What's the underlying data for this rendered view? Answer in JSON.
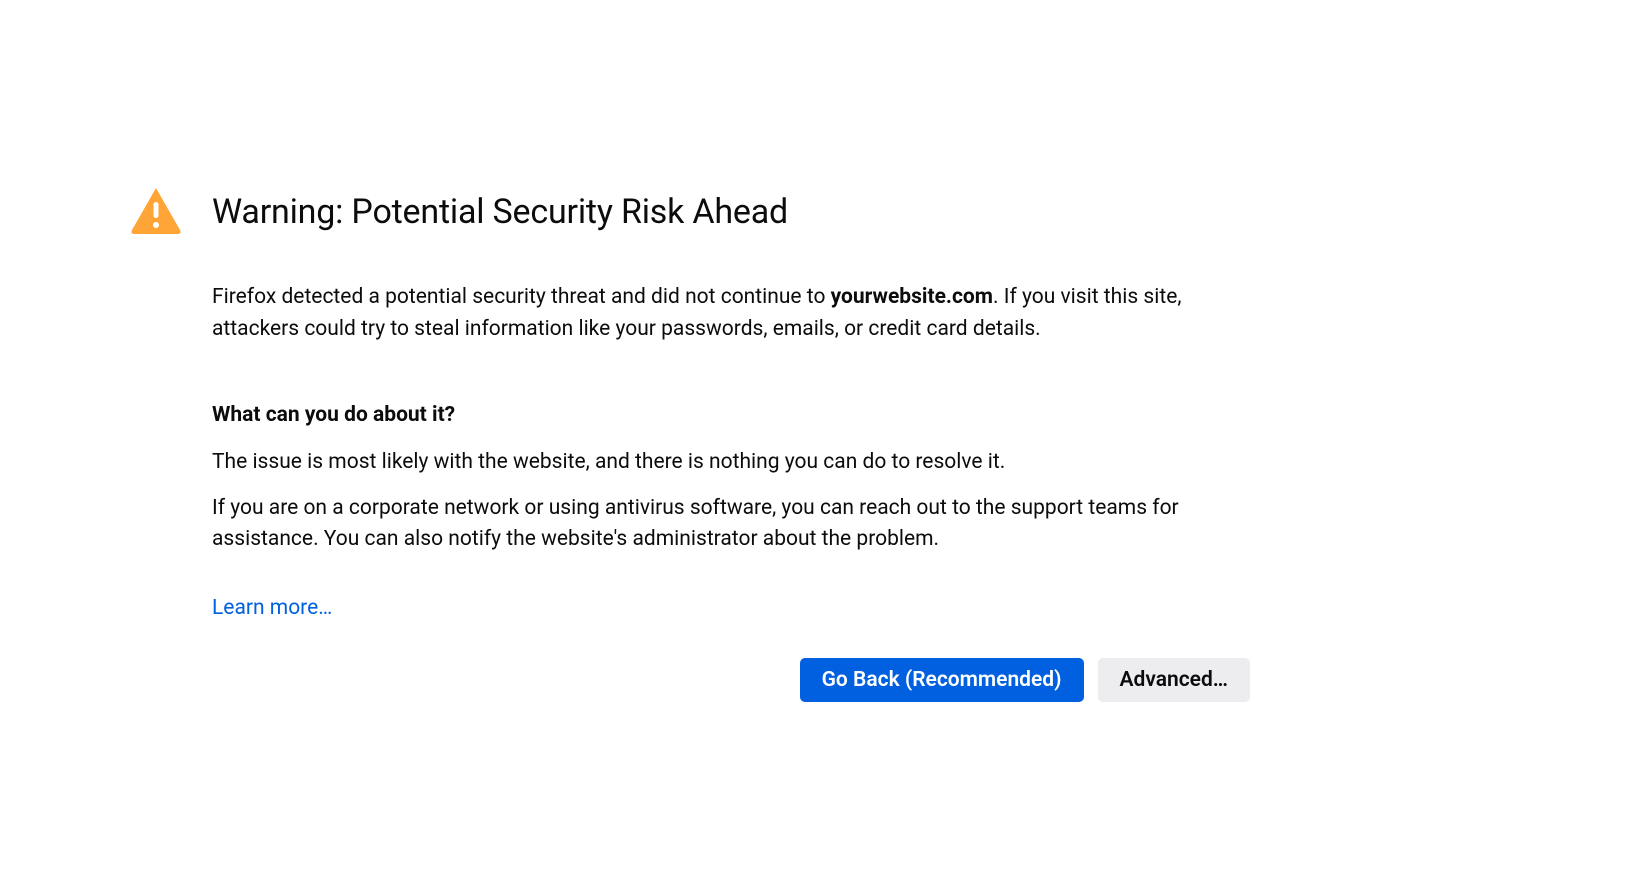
{
  "title": "Warning: Potential Security Risk Ahead",
  "intro": {
    "pre": "Firefox detected a potential security threat and did not continue to ",
    "domain": "yourwebsite.com",
    "post": ". If you visit this site, attackers could try to steal information like your passwords, emails, or credit card details."
  },
  "subheading": "What can you do about it?",
  "body1": "The issue is most likely with the website, and there is nothing you can do to resolve it.",
  "body2": "If you are on a corporate network or using antivirus software, you can reach out to the support teams for assistance. You can also notify the website's administrator about the problem.",
  "learn_more": "Learn more…",
  "buttons": {
    "go_back": "Go Back (Recommended)",
    "advanced": "Advanced…"
  },
  "colors": {
    "warning_icon": "#ffa436",
    "primary_button": "#0060df",
    "secondary_button": "#ededf0",
    "link": "#0060df"
  }
}
